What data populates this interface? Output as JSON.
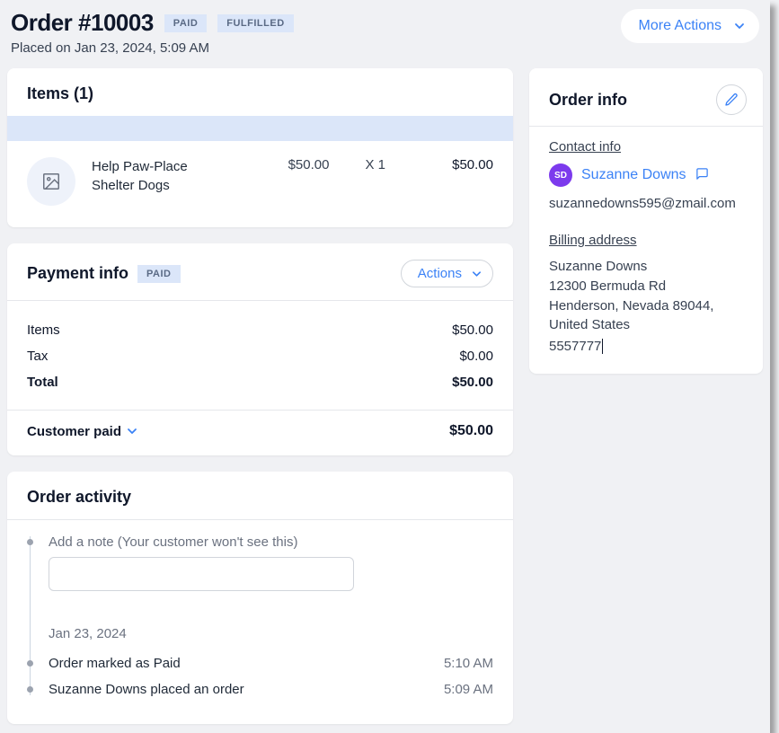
{
  "header": {
    "title": "Order #10003",
    "badges": {
      "paid": "PAID",
      "fulfilled": "FULFILLED"
    },
    "placed": "Placed on Jan 23, 2024, 5:09 AM",
    "moreActions": "More Actions"
  },
  "items": {
    "title": "Items (1)",
    "row": {
      "name": "Help Paw-Place Shelter Dogs",
      "price": "$50.00",
      "qty": "X 1",
      "total": "$50.00"
    }
  },
  "payment": {
    "title": "Payment info",
    "badge": "PAID",
    "actions": "Actions",
    "rows": {
      "itemsLabel": "Items",
      "itemsVal": "$50.00",
      "taxLabel": "Tax",
      "taxVal": "$0.00",
      "totalLabel": "Total",
      "totalVal": "$50.00"
    },
    "paidLabel": "Customer paid",
    "paidVal": "$50.00"
  },
  "activity": {
    "title": "Order activity",
    "noteLabel": "Add a note (Your customer won't see this)",
    "date": "Jan 23, 2024",
    "events": [
      {
        "text": "Order marked as Paid",
        "time": "5:10 AM"
      },
      {
        "text": "Suzanne Downs placed an order",
        "time": "5:09 AM"
      }
    ]
  },
  "info": {
    "title": "Order info",
    "contactLabel": "Contact info",
    "avatarInitials": "SD",
    "customerName": "Suzanne Downs",
    "email": "suzannedowns595@zmail.com",
    "billingLabel": "Billing address",
    "billingName": "Suzanne Downs",
    "billingStreet": "12300 Bermuda Rd",
    "billingCity": "Henderson, Nevada 89044, United States",
    "phone": "5557777"
  }
}
